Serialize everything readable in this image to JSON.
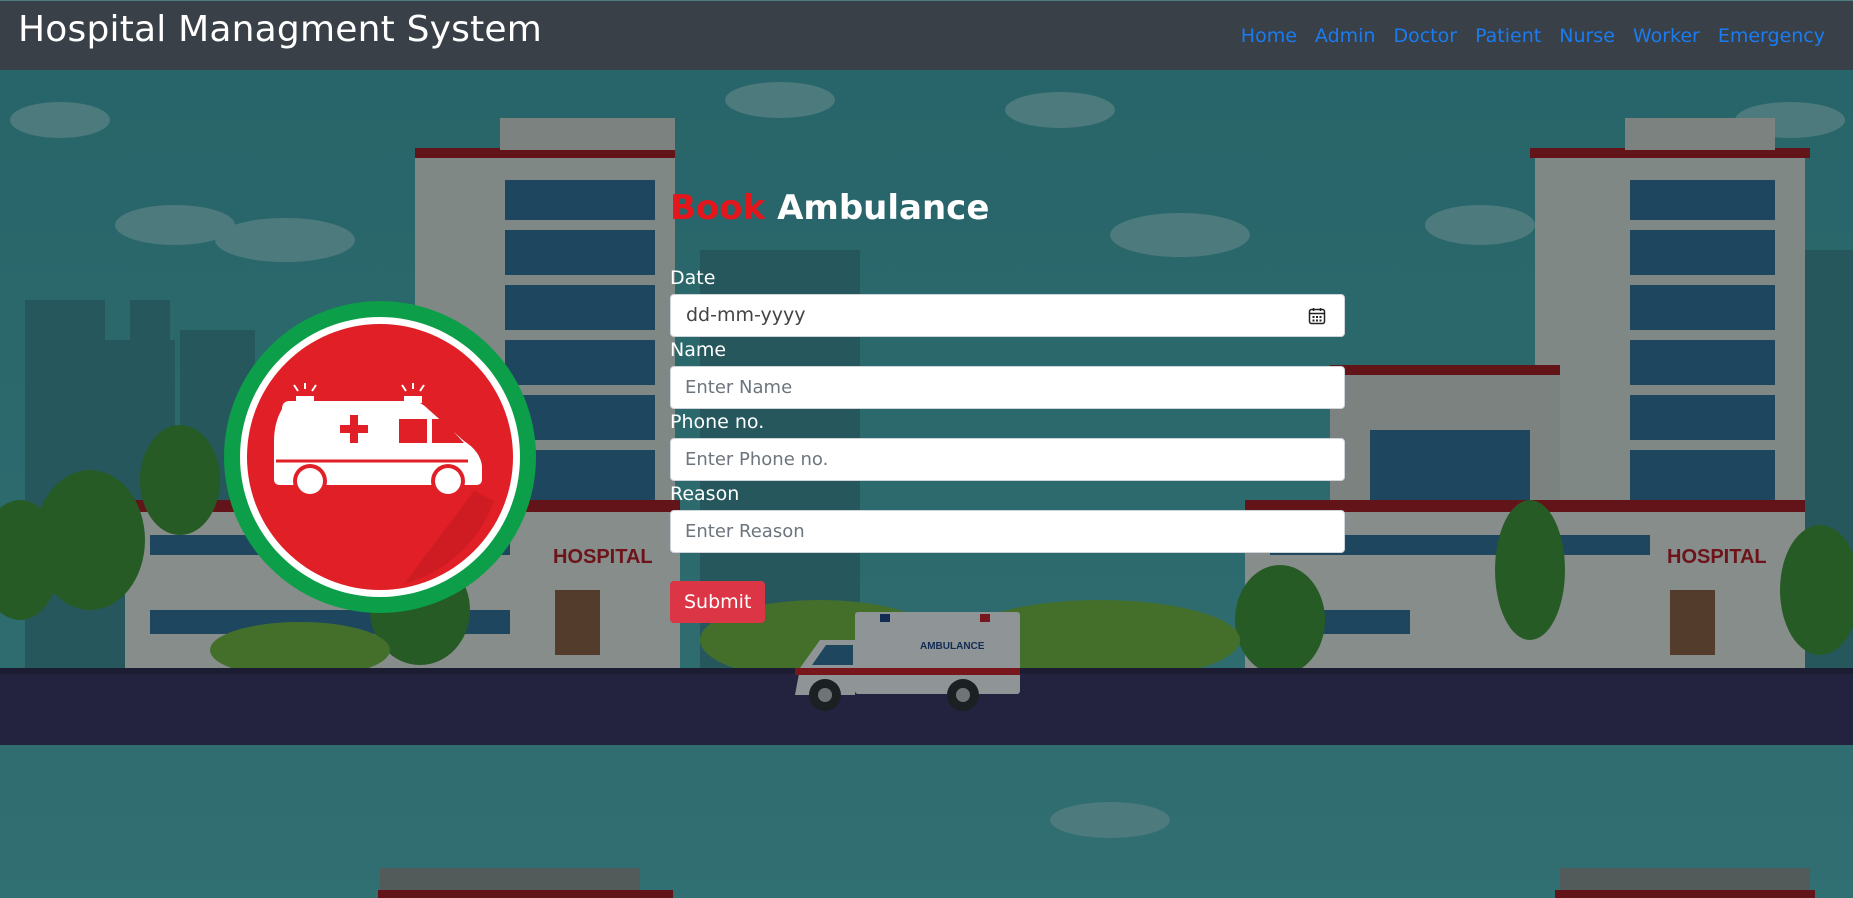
{
  "navbar": {
    "brand": "Hospital Managment System",
    "links": [
      "Home",
      "Admin",
      "Doctor",
      "Patient",
      "Nurse",
      "Worker",
      "Emergency"
    ],
    "link_color": "#1a7cf0"
  },
  "background": {
    "hospital_sign_left": "HOSPITAL",
    "hospital_sign_right": "HOSPITAL",
    "van_label": "AMBULANCE"
  },
  "form": {
    "title_accent": "Book",
    "title_rest": "Ambulance",
    "date": {
      "label": "Date",
      "placeholder": "dd-mm-yyyy"
    },
    "name": {
      "label": "Name",
      "placeholder": "Enter Name"
    },
    "phone": {
      "label": "Phone no.",
      "placeholder": "Enter Phone no."
    },
    "reason": {
      "label": "Reason",
      "placeholder": "Enter Reason"
    },
    "submit_label": "Submit"
  },
  "colors": {
    "accent_red": "#e4161c",
    "submit_red": "#dc3545",
    "logo_green": "#0c9e48",
    "logo_red": "#e01f26"
  },
  "icons": [
    "calendar-icon",
    "ambulance-logo-icon"
  ]
}
